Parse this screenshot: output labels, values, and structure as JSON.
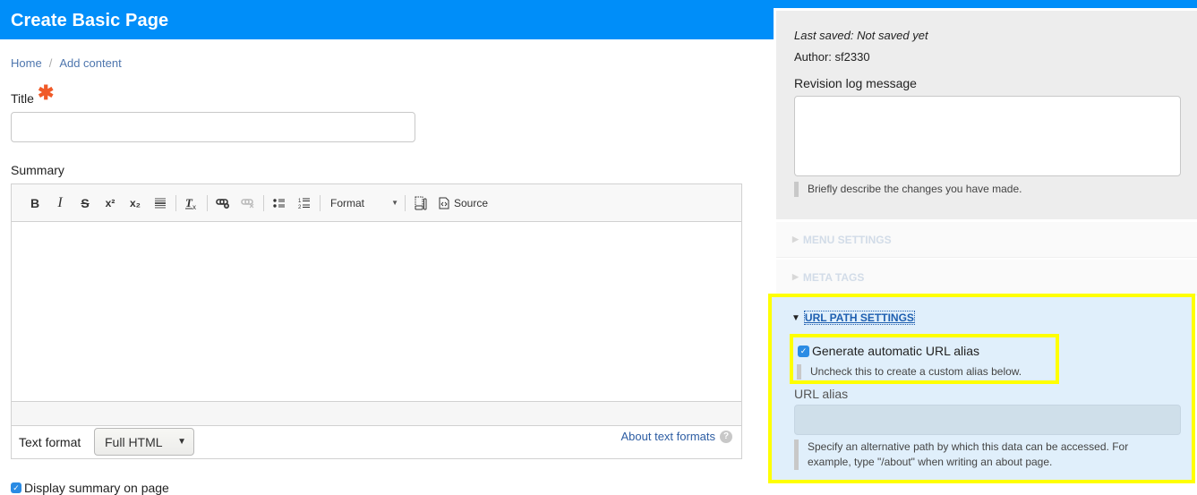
{
  "header": {
    "title": "Create Basic Page",
    "brand_color": "#008ef9"
  },
  "breadcrumb": {
    "items": [
      "Home",
      "Add content"
    ],
    "separator": "/"
  },
  "form": {
    "title_label": "Title",
    "required_marker": "✱",
    "title_value": "",
    "summary_label": "Summary",
    "editor": {
      "toolbar": {
        "bold": "B",
        "italic": "I",
        "strike": "S",
        "superscript": "x²",
        "subscript": "x₂",
        "format_label": "Format",
        "source_label": "Source"
      },
      "body_value": ""
    },
    "text_format_label": "Text format",
    "text_format_selected": "Full HTML",
    "about_text_formats": "About text formats",
    "display_summary_label": "Display summary on page",
    "display_summary_checked": true
  },
  "sidebar": {
    "last_saved": "Last saved: Not saved yet",
    "author": "Author: sf2330",
    "revision_log_label": "Revision log message",
    "revision_log_value": "",
    "revision_log_description": "Briefly describe the changes you have made.",
    "sections": [
      {
        "label": "MENU SETTINGS",
        "expanded": false
      },
      {
        "label": "META TAGS",
        "expanded": false
      },
      {
        "label": "URL PATH SETTINGS",
        "expanded": true
      }
    ],
    "url_path": {
      "auto_alias_label": "Generate automatic URL alias",
      "auto_alias_checked": true,
      "auto_alias_description": "Uncheck this to create a custom alias below.",
      "url_alias_label": "URL alias",
      "url_alias_value": "",
      "url_alias_description": "Specify an alternative path by which this data can be accessed. For example, type \"/about\" when writing an about page.",
      "highlight_color": "#ffff00"
    }
  }
}
